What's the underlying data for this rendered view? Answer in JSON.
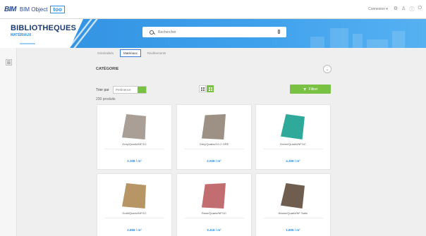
{
  "topbar": {
    "brand_mark": "BIM",
    "brand_text": "BIM Object",
    "brand_box": "too",
    "user_label": "Connexion ▾",
    "icons": [
      "settings-icon",
      "user-icon",
      "info-icon",
      "power-icon"
    ]
  },
  "banner": {
    "title": "BIBLIOTHEQUES",
    "subtitle": "MATÉRIAUX",
    "search_placeholder": "Rechercher"
  },
  "tabs": [
    {
      "label": "Généralités",
      "active": false
    },
    {
      "label": "Matériaux",
      "active": true
    },
    {
      "label": "Revêtements",
      "active": false
    }
  ],
  "category": {
    "title": "CATÉGORIE",
    "sort_label": "Trier par",
    "sort_value": "Pertinence",
    "count_label": "230 produits",
    "filter_label": "Filtrer"
  },
  "cards": [
    {
      "name": "Grey/Quartz/NF/1C",
      "price": "2.308 / m²",
      "color": "#a99f96"
    },
    {
      "name": "Grey/Quartz/1/1.2 GRE",
      "price": "2.008 / m²",
      "color": "#9c9184"
    },
    {
      "name": "Green/Quartz/NF/1C",
      "price": "4.308 / m²",
      "color": "#2fa99a"
    },
    {
      "name": "Gold/Quartz/NF/1C",
      "price": "2.868 / m²",
      "color": "#b89565"
    },
    {
      "name": "Rose/Quartz/NF/1C",
      "price": "3.418 / m²",
      "color": "#c26e70"
    },
    {
      "name": "Brown/Quartz/NF Satin",
      "price": "1.808 / m²",
      "color": "#6f5d4f"
    }
  ]
}
